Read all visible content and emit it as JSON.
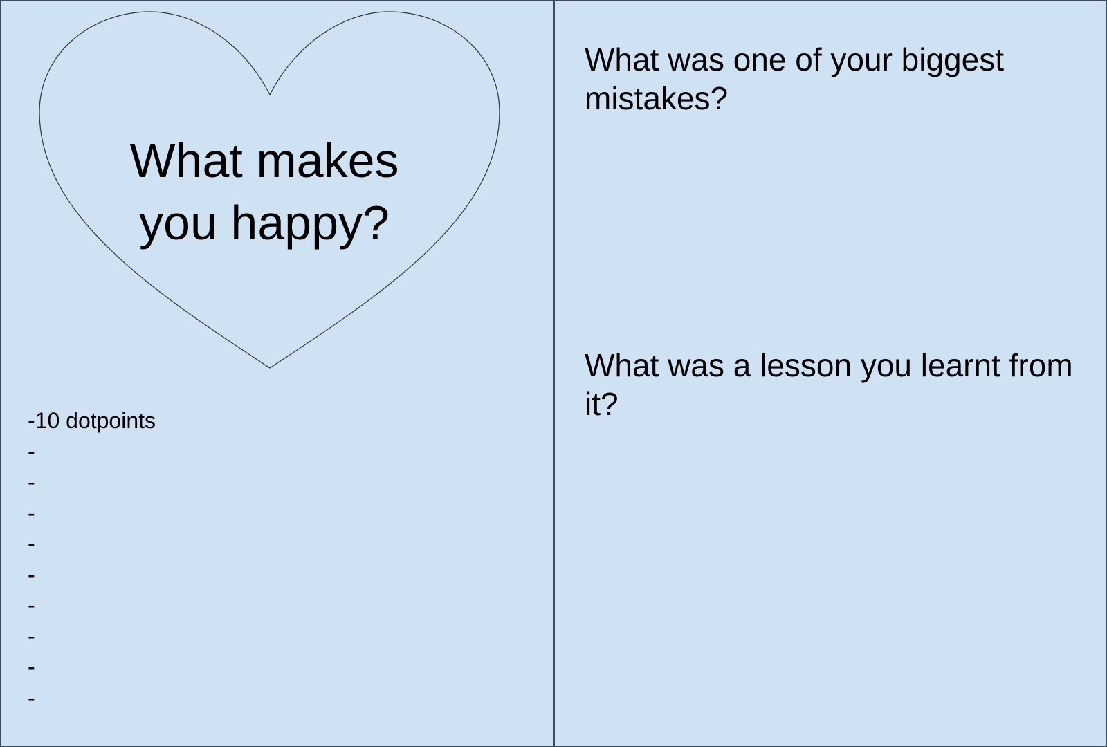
{
  "left_panel": {
    "heart_prompt": "What makes you happy?",
    "list_intro": "-10 dotpoints",
    "list_dashes": [
      "-",
      "-",
      "-",
      "-",
      "-",
      "-",
      "-",
      "-",
      "-"
    ]
  },
  "right_panel": {
    "question_one": "What was one of your biggest mistakes?",
    "question_two": "What was a lesson you learnt from it?"
  },
  "colors": {
    "background": "#cfe2f3",
    "border": "#3b4a5c"
  },
  "icons": {
    "heart": "heart-shape"
  }
}
